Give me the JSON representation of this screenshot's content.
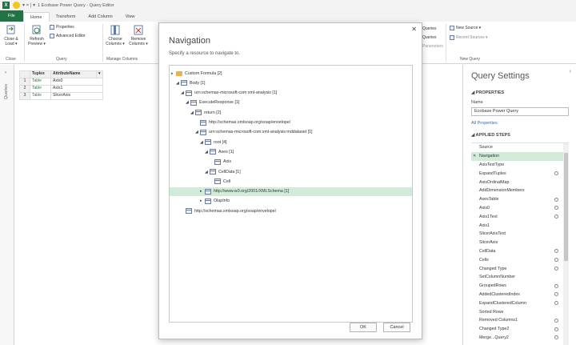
{
  "titlebar": {
    "excel_glyph": "X",
    "qa": "▾  =  |  ▾",
    "title": "1 Ecobase Power Query - Query Editor"
  },
  "tabs": [
    "File",
    "Home",
    "Transform",
    "Add Column",
    "View"
  ],
  "ribbon": {
    "close_load": "Close & Load ▾",
    "refresh_preview": "Refresh Preview ▾",
    "properties": "Properties",
    "advanced_editor": "Advanced Editor",
    "choose_columns": "Choose Columns ▾",
    "remove_columns": "Remove Columns ▾",
    "group_close": "Close",
    "group_query": "Query",
    "group_manage_columns": "Manage Columns",
    "frag_queries": "Queries",
    "frag_parameters": "Parameters",
    "frag_new_source": "New Source ▾",
    "frag_recent_sources": "Recent Sources ▾",
    "group_new_query": "New Query"
  },
  "queries_pane": {
    "label": "Queries",
    "chevron": "›"
  },
  "grid": {
    "headers": [
      "Tuples",
      "AttributeName"
    ],
    "rows": [
      {
        "n": "1",
        "tuple": "Table",
        "attr": "Axis0"
      },
      {
        "n": "2",
        "tuple": "Table",
        "attr": "Axis1"
      },
      {
        "n": "3",
        "tuple": "Table",
        "attr": "SlicerAxis"
      }
    ]
  },
  "navigation": {
    "title": "Navigation",
    "subtitle": "Specify a resource to navigate to.",
    "tree": [
      {
        "label": "Custom Formula [2]",
        "arrow": "▸",
        "folder": true
      },
      {
        "label": "Body [1]",
        "arrow": "◢"
      },
      {
        "label": "urn:schemas-microsoft-com:xml-analysis [1]",
        "arrow": "◢"
      },
      {
        "label": "ExecuteResponse [1]",
        "arrow": "◢"
      },
      {
        "label": "return [2]",
        "arrow": "◢"
      },
      {
        "label": "http://schemas.xmlsoap.org/soap/envelope/",
        "arrow": ""
      },
      {
        "label": "urn:schemas-microsoft-com:xml-analysis:mddataset [1]",
        "arrow": "◢"
      },
      {
        "label": "root [4]",
        "arrow": "◢"
      },
      {
        "label": "Axes [1]",
        "arrow": "◢"
      },
      {
        "label": "Axis",
        "arrow": ""
      },
      {
        "label": "CellData [1]",
        "arrow": "◢"
      },
      {
        "label": "Cell",
        "arrow": ""
      },
      {
        "label": "http://www.w3.org/2001/XMLSchema [1]",
        "arrow": "▸"
      },
      {
        "label": "OlapInfo",
        "arrow": "▸"
      },
      {
        "label": "http://schemas.xmlsoap.org/soap/envelope/",
        "arrow": ""
      }
    ],
    "ok": "OK",
    "cancel": "Cancel",
    "close": "✕"
  },
  "query_settings": {
    "title": "Query Settings",
    "collapse": "›",
    "properties_heading": "◢ PROPERTIES",
    "name_label": "Name",
    "name_value": "Ecobase Power Query",
    "all_properties": "All Properties",
    "applied_steps_heading": "◢ APPLIED STEPS",
    "steps": [
      "Source",
      "Navigation",
      "AxisTextType",
      "ExpandTuples",
      "AxisOrdinalMap",
      "AddDimensionMembers",
      "AxesTable",
      "Axis0",
      "Axis1Text",
      "Axis1",
      "SlicerAxisText",
      "SlicerAxis",
      "CellData",
      "Cells",
      "Changed Type",
      "SetColumnNumber",
      "GroupedRows",
      "AddedClusteredIndex",
      "ExpandClusteredColumn",
      "Sorted Rows",
      "Removed Columns1",
      "Changed Type2",
      "Merge...Query2"
    ],
    "delete_glyph": "✕"
  }
}
